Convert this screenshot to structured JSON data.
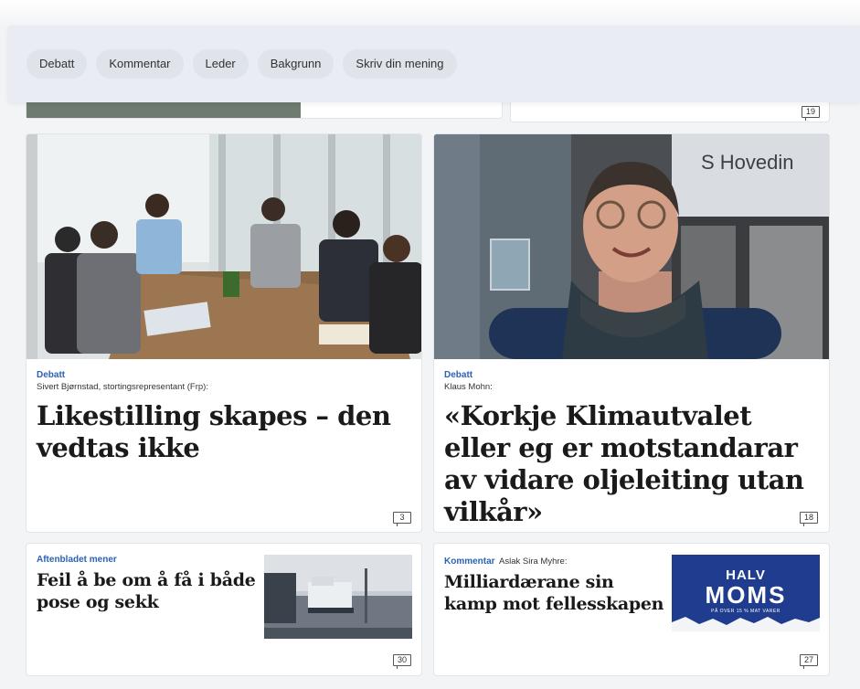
{
  "nav": {
    "pills": [
      "Debatt",
      "Kommentar",
      "Leder",
      "Bakgrunn",
      "Skriv din mening"
    ]
  },
  "peek": {
    "right_comments": "19"
  },
  "articles": [
    {
      "section": "Debatt",
      "byline": "Sivert Bjørnstad, stortingsrepresentant (Frp):",
      "headline": "Likestilling skapes – den vedtas ikke",
      "comments": "3"
    },
    {
      "section": "Debatt",
      "byline": "Klaus Mohn:",
      "headline": "«Korkje Klimautvalet eller eg er motstandarar av vidare oljeleiting utan vilkår»",
      "comments": "18",
      "image_sign": "S Hovedin"
    },
    {
      "section": "Aftenbladet mener",
      "headline": "Feil å be om å få i både pose og sekk",
      "comments": "30"
    },
    {
      "section": "Kommentar",
      "byline": "Aslak Sira Myhre:",
      "headline": "Milliardærane sin kamp mot fellesskapen",
      "comments": "27",
      "image_text": {
        "top": "HALV",
        "main": "MOMS",
        "sub": "PÅ OVER 15 % MAT VARER"
      }
    }
  ],
  "colors": {
    "section_blue": "#2b63b5",
    "nav_bg": "#e9ecf3",
    "pill_bg": "#dfe3ea",
    "moms_blue": "#1f3c8e"
  }
}
